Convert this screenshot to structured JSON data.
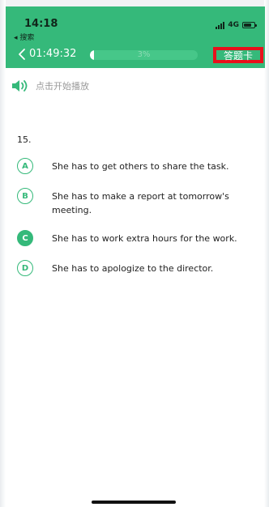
{
  "status_bar": {
    "time": "14:18",
    "back_label": "◂ 搜索",
    "network": "4G"
  },
  "header": {
    "timer": "01:49:32",
    "progress_value": 0.03,
    "progress_label": "3%",
    "answer_card_label": "答题卡"
  },
  "audio": {
    "play_label": "点击开始播放"
  },
  "question": {
    "number": "15.",
    "selected": "C",
    "options": [
      {
        "letter": "A",
        "text": "She has to get others to share the task."
      },
      {
        "letter": "B",
        "text": "She has to make a report at tomorrow's meeting."
      },
      {
        "letter": "C",
        "text": "She has to work extra hours for the work."
      },
      {
        "letter": "D",
        "text": "She has to apologize to the director."
      }
    ]
  },
  "colors": {
    "accent": "#35b97a",
    "highlight_border": "#e8101c"
  }
}
